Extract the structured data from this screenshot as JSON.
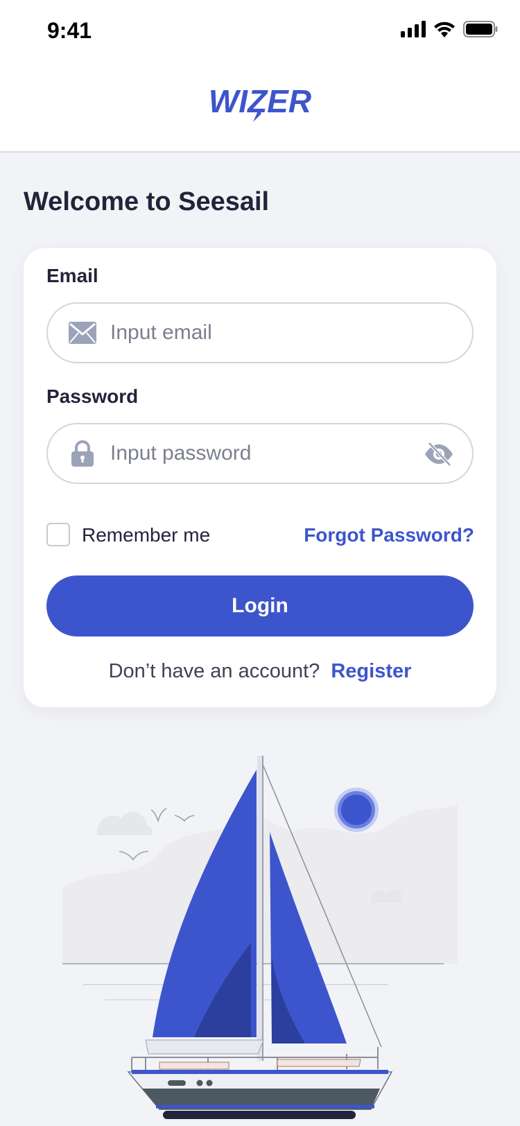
{
  "status_bar": {
    "time": "9:41"
  },
  "brand": {
    "logo_text": "WIZER",
    "accent": "#3d55cc"
  },
  "page": {
    "title": "Welcome to Seesail"
  },
  "form": {
    "email": {
      "label": "Email",
      "placeholder": "Input email",
      "icon": "envelope-icon"
    },
    "password": {
      "label": "Password",
      "placeholder": "Input password",
      "icon": "lock-icon",
      "toggle_icon": "eye-off-icon"
    },
    "remember_label": "Remember me",
    "remember_checked": false,
    "forgot_label": "Forgot Password?",
    "login_label": "Login",
    "register_prompt": "Don’t have an account?",
    "register_link": "Register"
  },
  "colors": {
    "background": "#f2f3f7",
    "primary": "#3d55cc",
    "text": "#23243a"
  }
}
